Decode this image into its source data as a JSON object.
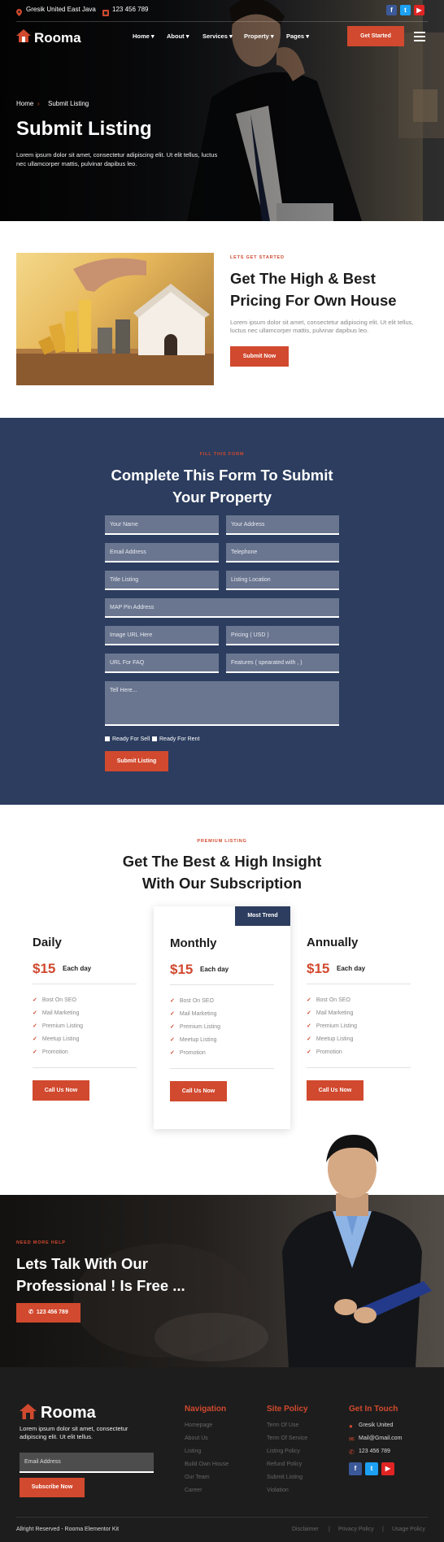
{
  "topbar": {
    "location": "Gresik United East Java",
    "phone": "123 456 789"
  },
  "brand": {
    "name": "Rooma",
    "accent": "#d1492e",
    "navy": "#2c3d5f"
  },
  "nav": {
    "items": [
      {
        "label": "Home"
      },
      {
        "label": "About"
      },
      {
        "label": "Services"
      },
      {
        "label": "Property"
      },
      {
        "label": "Pages"
      }
    ],
    "cta": "Get Started"
  },
  "hero": {
    "breadcrumb": [
      "Home",
      "Submit Listing"
    ],
    "title": "Submit Listing",
    "description": "Lorem ipsum dolor sit amet, consectetur adipiscing elit. Ut elit tellus, luctus nec ullamcorper mattis, pulvinar dapibus leo."
  },
  "intro": {
    "eyebrow": "LETS GET STARTED",
    "title_line1": "Get The High & Best",
    "title_line2": "Pricing For Own House",
    "description": "Lorem ipsum dolor sit amet, consectetur adipiscing elit. Ut elit tellus, luctus nec ullamcorper mattis, pulvinar dapibus leo.",
    "button": "Submit Now"
  },
  "form": {
    "eyebrow": "FILL THIS FORM",
    "title_line1": "Complete This Form To Submit",
    "title_line2": "Your Property",
    "fields": {
      "name": "Your Name",
      "address": "Your Address",
      "email": "Email Address",
      "telephone": "Telephone",
      "title": "Title Listing",
      "location": "Listing Location",
      "map": "MAP Pin Address",
      "image": "Image URL Here",
      "pricing": "Pricing ( USD )",
      "faq": "URL For FAQ",
      "features": "Features ( spearated with , )",
      "message": "Tell Here..."
    },
    "checkbox_sell": "Ready For Sell",
    "checkbox_rent": "Ready For Rent",
    "submit": "Submit Listing"
  },
  "pricing": {
    "eyebrow": "PREMIUM LISTING",
    "title_line1": "Get The Best & High Insight",
    "title_line2": "With Our Subscription",
    "badge": "Most Trend",
    "plans": [
      {
        "name": "Daily",
        "price": "$15",
        "period": "Each day"
      },
      {
        "name": "Monthly",
        "price": "$15",
        "period": "Each day"
      },
      {
        "name": "Annually",
        "price": "$15",
        "period": "Each day"
      }
    ],
    "features": [
      "Bost On SEO",
      "Mail Marketing",
      "Premium Listing",
      "Meetup Listing",
      "Promotion"
    ],
    "button": "Call Us Now"
  },
  "cta": {
    "eyebrow": "NEED MORE HELP",
    "title_line1": "Lets Talk With Our",
    "title_line2": "Professional ! Is Free ...",
    "phone": "123 456 789"
  },
  "footer": {
    "brand": "Rooma",
    "description": "Lorem ipsum dolor sit amet, consectetur adipiscing elit. Ut elit tellus.",
    "email_placeholder": "Email Address",
    "subscribe": "Subscribe Now",
    "navigation_title": "Navigation",
    "navigation": [
      "Homepage",
      "About Us",
      "Listing",
      "Build Own House",
      "Our Team",
      "Career"
    ],
    "policy_title": "Site Policy",
    "policy": [
      "Term Of Use",
      "Term Of Service",
      "Listing Policy",
      "Refund Policy",
      "Submit Listing",
      "Violation"
    ],
    "contact_title": "Get In Touch",
    "contact": [
      "Gresik United",
      "Mail@Gmail.com",
      "123 456 789"
    ],
    "copyright": "Allright Reserved - Rooma Elementor Kit",
    "bottom_links": [
      "Disclaimer",
      "Privacy Policy",
      "Usage Policy"
    ]
  }
}
